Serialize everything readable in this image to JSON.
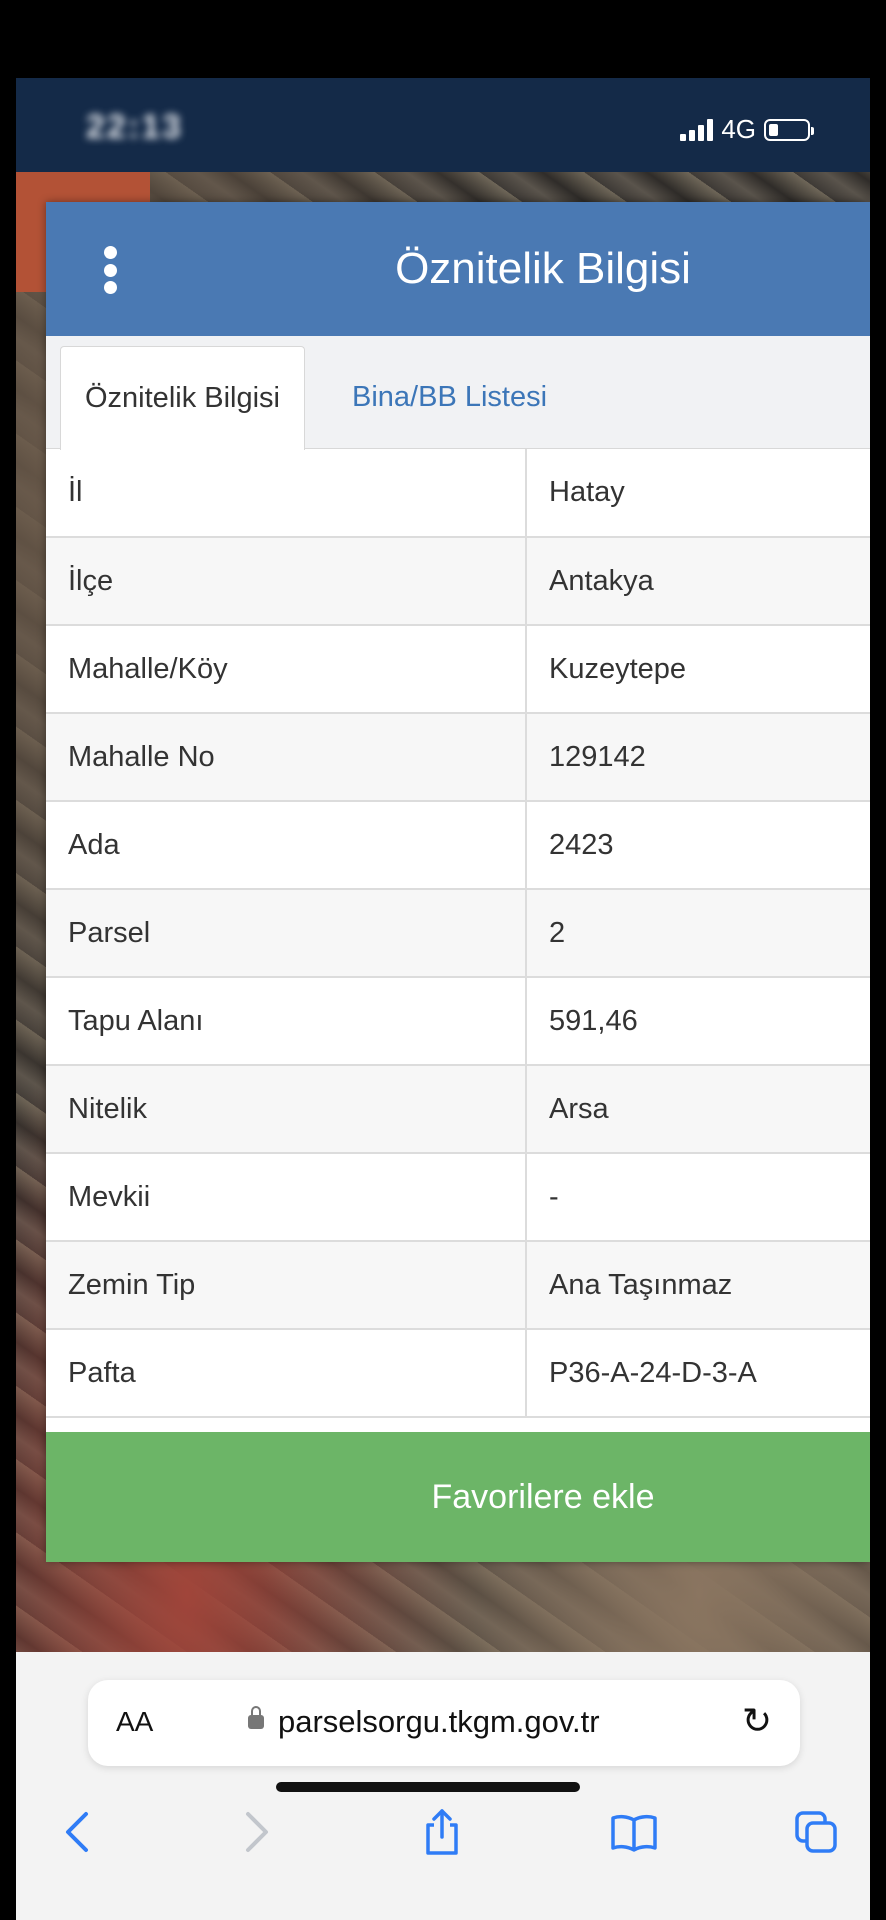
{
  "status": {
    "time": "22:13",
    "network": "4G"
  },
  "panel": {
    "title": "Öznitelik Bilgisi",
    "tabs": [
      {
        "label": "Öznitelik Bilgisi",
        "active": true
      },
      {
        "label": "Bina/BB Listesi",
        "active": false
      }
    ],
    "rows": [
      {
        "key": "İl",
        "value": "Hatay"
      },
      {
        "key": "İlçe",
        "value": "Antakya"
      },
      {
        "key": "Mahalle/Köy",
        "value": "Kuzeytepe"
      },
      {
        "key": "Mahalle No",
        "value": "129142"
      },
      {
        "key": "Ada",
        "value": "2423"
      },
      {
        "key": "Parsel",
        "value": "2"
      },
      {
        "key": "Tapu Alanı",
        "value": "591,46"
      },
      {
        "key": "Nitelik",
        "value": "Arsa"
      },
      {
        "key": "Mevkii",
        "value": "-"
      },
      {
        "key": "Zemin Tip",
        "value": "Ana Taşınmaz"
      },
      {
        "key": "Pafta",
        "value": "P36-A-24-D-3-A"
      }
    ],
    "favorite_label": "Favorilere ekle"
  },
  "browser": {
    "text_size_label": "AA",
    "url": "parselsorgu.tkgm.gov.tr"
  },
  "colors": {
    "header": "#4a79b3",
    "button": "#6cb567",
    "link": "#3c76b8",
    "ios_blue": "#2f7cf6"
  }
}
